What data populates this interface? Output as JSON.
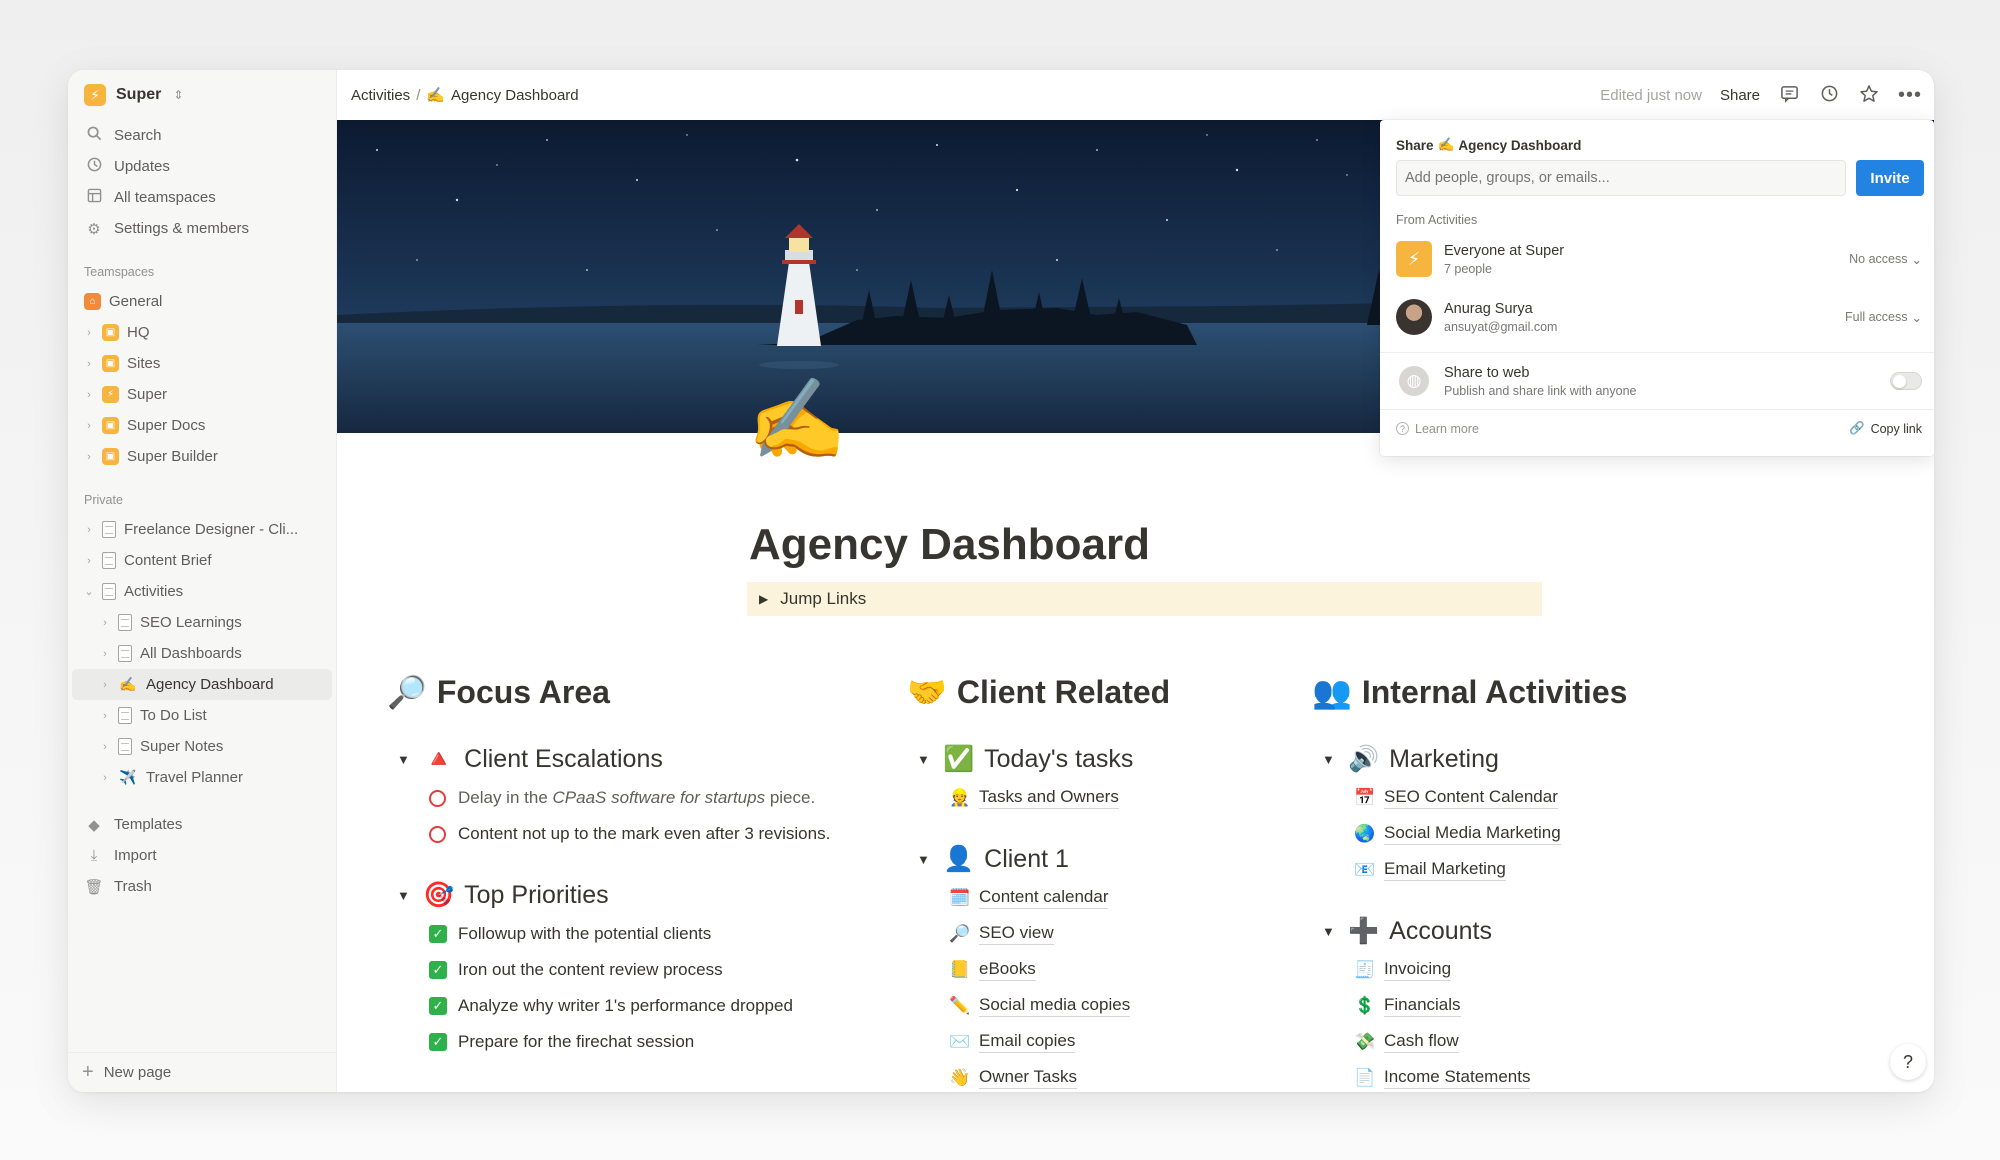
{
  "workspace": {
    "name": "Super",
    "logo_icon": "bolt-icon",
    "accent": "#f6b53f"
  },
  "sidebar": {
    "nav": [
      {
        "label": "Search",
        "icon": "search-icon"
      },
      {
        "label": "Updates",
        "icon": "clock-icon"
      },
      {
        "label": "All teamspaces",
        "icon": "grid-icon"
      },
      {
        "label": "Settings & members",
        "icon": "gear-icon"
      }
    ],
    "teamspaces_label": "Teamspaces",
    "teamspaces": [
      {
        "label": "General"
      },
      {
        "label": "HQ"
      },
      {
        "label": "Sites"
      },
      {
        "label": "Super"
      },
      {
        "label": "Super Docs"
      },
      {
        "label": "Super Builder"
      }
    ],
    "private_label": "Private",
    "private": [
      {
        "label": "Freelance Designer - Cli..."
      },
      {
        "label": "Content Brief"
      },
      {
        "label": "Activities"
      },
      {
        "label": "SEO Learnings"
      },
      {
        "label": "All Dashboards"
      },
      {
        "label": "Agency Dashboard"
      },
      {
        "label": "To Do List"
      },
      {
        "label": "Super Notes"
      },
      {
        "label": "Travel Planner"
      }
    ],
    "tools": [
      {
        "label": "Templates",
        "icon": "shapes-icon"
      },
      {
        "label": "Import",
        "icon": "download-icon"
      },
      {
        "label": "Trash",
        "icon": "trash-icon"
      }
    ],
    "new_page": "New page"
  },
  "topbar": {
    "breadcrumb_parent": "Activities",
    "breadcrumb_sep": "/",
    "breadcrumb_emoji": "✍️",
    "breadcrumb_current": "Agency Dashboard",
    "edited": "Edited just now",
    "share": "Share"
  },
  "page": {
    "icon": "✍️",
    "title": "Agency Dashboard",
    "callout": "Jump Links"
  },
  "focus": {
    "heading_emoji": "🔎",
    "heading": "Focus Area",
    "escalations_emoji": "🔺",
    "escalations": "Client Escalations",
    "esc_item1_a": "Delay in the ",
    "esc_item1_em": "CPaaS software for startups",
    "esc_item1_b": " piece.",
    "esc_item2": "Content not up to the mark even after 3 revisions.",
    "priorities_emoji": "🎯",
    "priorities": "Top Priorities",
    "priority_items": [
      "Followup with the potential clients",
      "Iron out the content review process",
      "Analyze why writer 1's performance dropped",
      "Prepare for the firechat session"
    ]
  },
  "client": {
    "heading_emoji": "🤝",
    "heading": "Client Related",
    "tasks_emoji": "✅",
    "tasks": "Today's tasks",
    "tasks_items": [
      {
        "emoji": "👷",
        "label": "Tasks and Owners"
      }
    ],
    "client1_emoji": "👤",
    "client1": "Client 1",
    "client1_items": [
      {
        "emoji": "🗓️",
        "label": "Content calendar"
      },
      {
        "emoji": "🔎",
        "label": "SEO view"
      },
      {
        "emoji": "📒",
        "label": "eBooks"
      },
      {
        "emoji": "✏️",
        "label": "Social media copies"
      },
      {
        "emoji": "✉️",
        "label": "Email copies"
      },
      {
        "emoji": "👋",
        "label": "Owner Tasks"
      }
    ]
  },
  "internal": {
    "heading_emoji": "👥",
    "heading": "Internal Activities",
    "marketing_emoji": "🔊",
    "marketing": "Marketing",
    "marketing_items": [
      {
        "emoji": "📅",
        "label": "SEO Content Calendar"
      },
      {
        "emoji": "🌏",
        "label": "Social Media Marketing"
      },
      {
        "emoji": "📧",
        "label": "Email Marketing"
      }
    ],
    "accounts_emoji": "➕",
    "accounts": "Accounts",
    "accounts_items": [
      {
        "emoji": "🧾",
        "label": "Invoicing"
      },
      {
        "emoji": "💲",
        "label": "Financials"
      },
      {
        "emoji": "💸",
        "label": "Cash flow"
      },
      {
        "emoji": "📄",
        "label": "Income Statements"
      }
    ]
  },
  "share_popup": {
    "title_prefix": "Share",
    "title_emoji": "✍️",
    "title_page": "Agency Dashboard",
    "input_placeholder": "Add people, groups, or emails...",
    "invite": "Invite",
    "from_label": "From Activities",
    "people": [
      {
        "name": "Everyone at Super",
        "sub": "7 people",
        "access": "No access"
      },
      {
        "name": "Anurag Surya",
        "sub": "ansuyat@gmail.com",
        "access": "Full access"
      }
    ],
    "web_title": "Share to web",
    "web_sub": "Publish and share link with anyone",
    "learn_more": "Learn more",
    "copy_link": "Copy link"
  },
  "help": "?"
}
